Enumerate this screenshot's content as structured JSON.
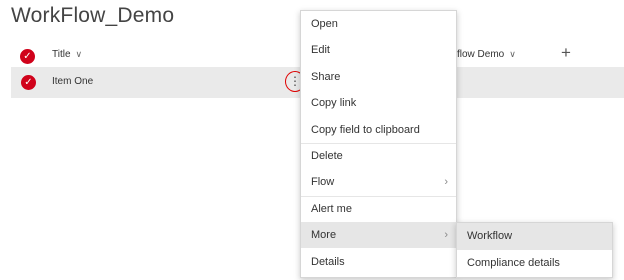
{
  "page": {
    "title": "WorkFlow_Demo"
  },
  "columns": {
    "title_label": "Title",
    "workflow_label": "flow Demo"
  },
  "row": {
    "title": "Item One",
    "more_glyph": "⋮"
  },
  "icons": {
    "check": "check-circle-icon",
    "chevron": "chevron-down-icon",
    "add": "plus-icon",
    "submenu": "chevron-right-icon"
  },
  "colors": {
    "accent": "#d0021b",
    "highlight": "#e00000",
    "menu_hover": "#e6e6e6"
  },
  "context_menu": {
    "items": [
      {
        "label": "Open"
      },
      {
        "label": "Edit"
      },
      {
        "label": "Share"
      },
      {
        "label": "Copy link"
      },
      {
        "label": "Copy field to clipboard"
      },
      {
        "label": "Delete"
      },
      {
        "label": "Flow",
        "has_submenu": true
      },
      {
        "label": "Alert me"
      },
      {
        "label": "More",
        "has_submenu": true,
        "active": true
      },
      {
        "label": "Details"
      }
    ]
  },
  "submenu": {
    "items": [
      {
        "label": "Workflow",
        "active": true
      },
      {
        "label": "Compliance details"
      }
    ]
  }
}
